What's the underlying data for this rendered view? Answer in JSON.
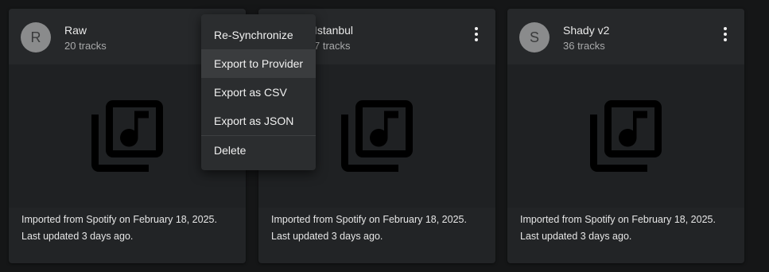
{
  "cards": [
    {
      "avatar_letter": "R",
      "title": "Raw",
      "subtitle": "20 tracks",
      "import_text": "Imported from Spotify on February 18, 2025.",
      "updated_text": "Last updated 3 days ago."
    },
    {
      "avatar_letter": "",
      "title": "Istanbul",
      "subtitle": "7 tracks",
      "import_text": "Imported from Spotify on February 18, 2025.",
      "updated_text": "Last updated 3 days ago."
    },
    {
      "avatar_letter": "S",
      "title": "Shady v2",
      "subtitle": "36 tracks",
      "import_text": "Imported from Spotify on February 18, 2025.",
      "updated_text": "Last updated 3 days ago."
    }
  ],
  "context_menu": {
    "items": [
      {
        "label": "Re-Synchronize"
      },
      {
        "label": "Export to Provider",
        "hovered": true
      },
      {
        "label": "Export as CSV"
      },
      {
        "label": "Export as JSON"
      },
      {
        "label": "Delete"
      }
    ]
  },
  "icons": {
    "kebab": "more-vertical-icon",
    "playlist_placeholder": "library-music-icon"
  },
  "colors": {
    "background": "#151617",
    "card": "#222426",
    "menu": "#2b2d2f"
  }
}
